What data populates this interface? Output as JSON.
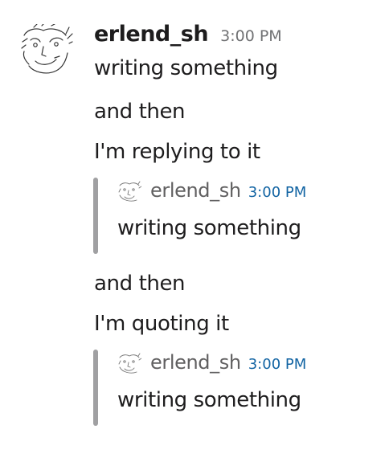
{
  "message": {
    "author": "erlend_sh",
    "timestamp": "3:00 PM",
    "lines": [
      "writing something",
      "and then",
      "I'm replying to it",
      "and then",
      "I'm quoting it"
    ]
  },
  "reply_attachment": {
    "author": "erlend_sh",
    "timestamp": "3:00 PM",
    "text": "writing something"
  },
  "quote_attachment": {
    "author": "erlend_sh",
    "timestamp": "3:00 PM",
    "text": "writing something"
  },
  "colors": {
    "text": "#1d1c1d",
    "muted": "#717274",
    "link": "#1264a3",
    "quote_bar": "#a0a0a2"
  },
  "icons": {
    "avatar": "sketch-face-avatar",
    "attachment_avatar": "sketch-face-avatar-small"
  }
}
